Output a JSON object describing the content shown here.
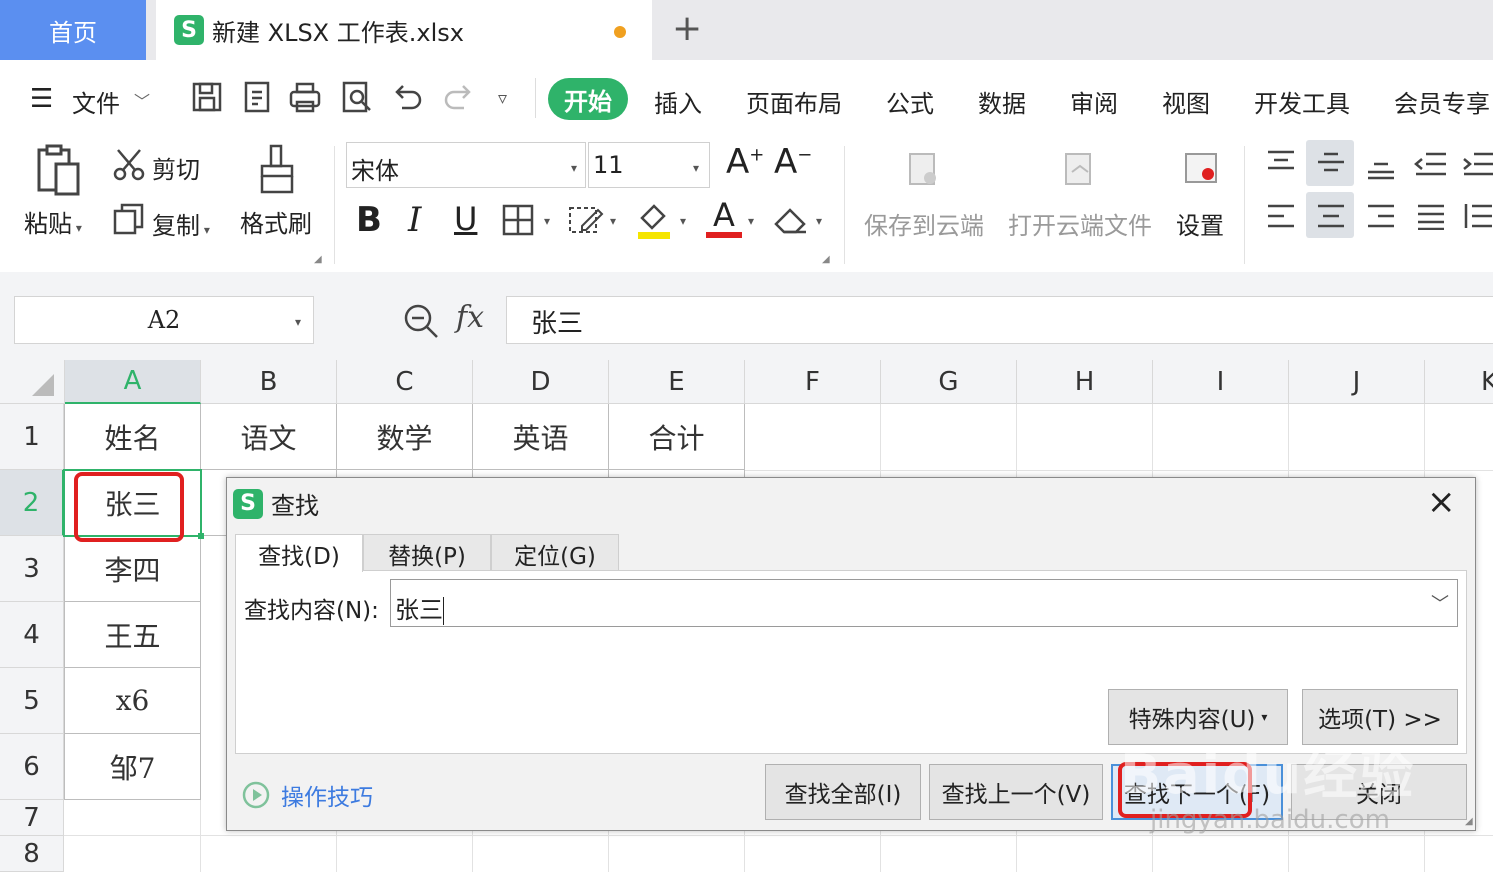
{
  "tabs": {
    "home": "首页",
    "file_name": "新建 XLSX 工作表.xlsx",
    "logo_letter": "S",
    "new_tab": "+"
  },
  "menu": {
    "file": "文件",
    "items": [
      "开始",
      "插入",
      "页面布局",
      "公式",
      "数据",
      "审阅",
      "视图",
      "开发工具",
      "会员专享"
    ]
  },
  "ribbon": {
    "paste": "粘贴",
    "cut": "剪切",
    "copy": "复制",
    "format_painter": "格式刷",
    "font_name": "宋体",
    "font_size": "11",
    "bold": "B",
    "italic": "I",
    "underline": "U",
    "save_cloud": "保存到云端",
    "open_cloud": "打开云端文件",
    "settings": "设置",
    "font_grow": "A",
    "font_shrink": "A",
    "font_color_letter": "A"
  },
  "formula_bar": {
    "name_box": "A2",
    "fx": "fx",
    "value": "张三"
  },
  "grid": {
    "columns": [
      "A",
      "B",
      "C",
      "D",
      "E",
      "F",
      "G",
      "H",
      "I",
      "J",
      "K"
    ],
    "rows": [
      "1",
      "2",
      "3",
      "4",
      "5",
      "6",
      "7",
      "8"
    ],
    "headers": [
      "姓名",
      "语文",
      "数学",
      "英语",
      "合计"
    ],
    "col_a": [
      "张三",
      "李四",
      "王五",
      "x6",
      "邹7"
    ]
  },
  "dialog": {
    "title": "查找",
    "close": "×",
    "tabs": [
      "查找(D)",
      "替换(P)",
      "定位(G)"
    ],
    "find_label": "查找内容(N):",
    "find_value": "张三",
    "special_btn": "特殊内容(U)",
    "options_btn": "选项(T) >>",
    "tips": "操作技巧",
    "find_all": "查找全部(I)",
    "find_prev": "查找上一个(V)",
    "find_next": "查找下一个(F)",
    "close_btn": "关闭"
  },
  "watermark": {
    "brand": "Baidu经验",
    "url": "jingyan.baidu.com"
  },
  "colors": {
    "accent_green": "#2fb36a",
    "home_tab_blue": "#5b8ff0",
    "highlight_red": "#e02020",
    "unsaved_dot": "#f0a020"
  }
}
